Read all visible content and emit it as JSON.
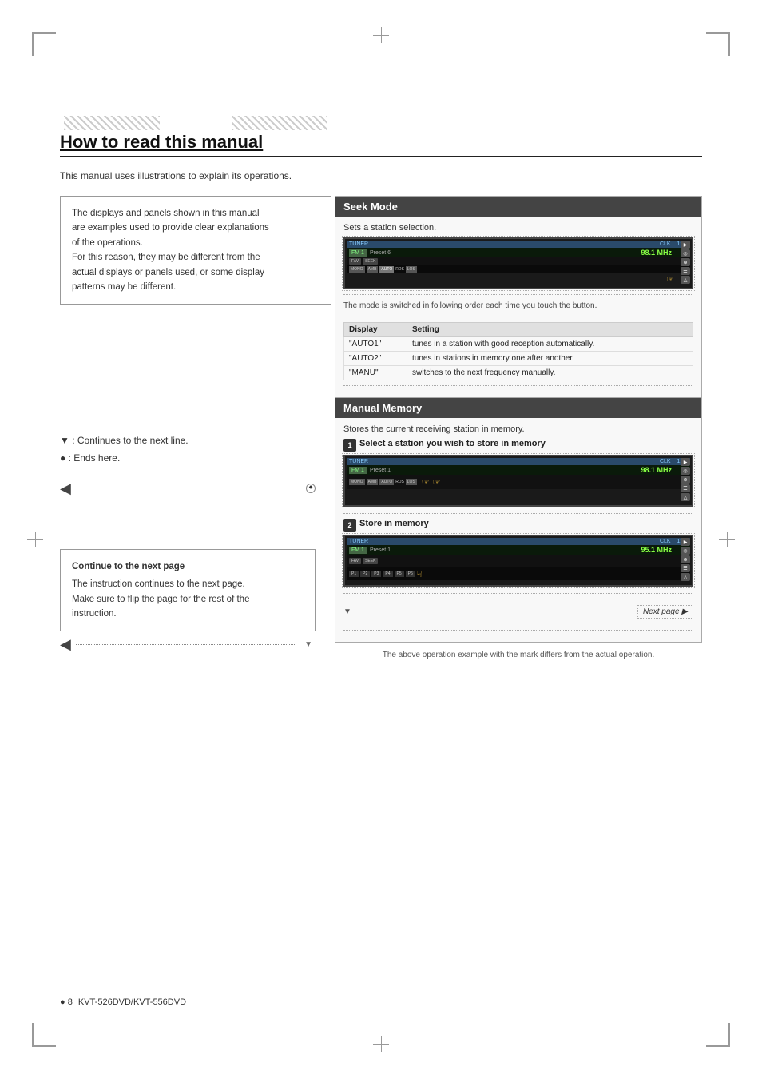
{
  "page": {
    "title": "How to read this manual",
    "intro": "This manual uses illustrations to explain its operations.",
    "info_box": {
      "line1": "The displays and panels shown in this manual",
      "line2": "are examples used to provide clear explanations",
      "line3": "of the operations.",
      "line4": "For this reason, they may be different from the",
      "line5": "actual displays or panels used, or some display",
      "line6": "patterns may be different."
    },
    "bullets": [
      "▼ : Continues to the next line.",
      "● : Ends here."
    ],
    "continue_box": {
      "title": "Continue to the next page",
      "line1": "The instruction continues to the next page.",
      "line2": "Make sure to flip the page for the rest of the",
      "line3": "instruction."
    },
    "seek_mode": {
      "header": "Seek Mode",
      "desc": "Sets a station selection.",
      "switched_text": "The mode is switched in following order each time you touch the button.",
      "table": {
        "headers": [
          "Display",
          "Setting"
        ],
        "rows": [
          [
            "“AUTO1”",
            "tunes in a station with good reception automatically."
          ],
          [
            "“AUTO2”",
            "tunes in stations in memory one after another."
          ],
          [
            "“MANU”",
            "switches to the next frequency manually."
          ]
        ]
      },
      "tuner_label": "TUNER",
      "preset_label": "Preset",
      "preset_num": "6",
      "freq": "98.1 MHz"
    },
    "manual_memory": {
      "header": "Manual Memory",
      "desc": "Stores the current receiving station in memory.",
      "step1_label": "Select a station you wish to store in memory",
      "step2_label": "Store in memory",
      "tuner_label": "TUNER",
      "preset_label": "Preset",
      "preset_num": "1",
      "freq1": "98.1 MHz",
      "freq2": "95.1 MHz",
      "next_page": "Next page ▶"
    },
    "bottom_note": "The above operation example with the mark differs from the actual operation.",
    "page_number": "8",
    "model": "KVT-526DVD/KVT-556DVD",
    "circle_icon": "●"
  }
}
